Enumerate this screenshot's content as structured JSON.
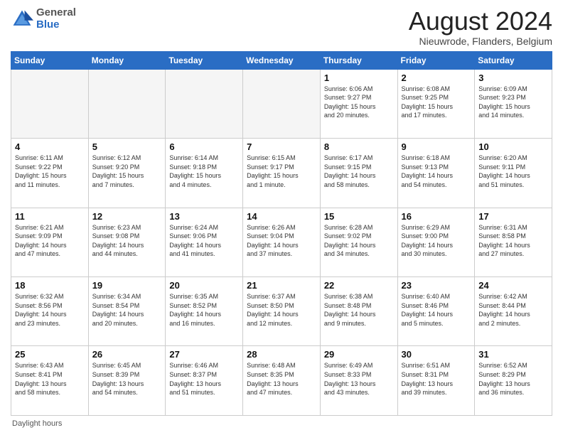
{
  "header": {
    "logo_general": "General",
    "logo_blue": "Blue",
    "month_title": "August 2024",
    "location": "Nieuwrode, Flanders, Belgium"
  },
  "days_of_week": [
    "Sunday",
    "Monday",
    "Tuesday",
    "Wednesday",
    "Thursday",
    "Friday",
    "Saturday"
  ],
  "footer_note": "Daylight hours",
  "weeks": [
    [
      {
        "day": "",
        "detail": ""
      },
      {
        "day": "",
        "detail": ""
      },
      {
        "day": "",
        "detail": ""
      },
      {
        "day": "",
        "detail": ""
      },
      {
        "day": "1",
        "detail": "Sunrise: 6:06 AM\nSunset: 9:27 PM\nDaylight: 15 hours\nand 20 minutes."
      },
      {
        "day": "2",
        "detail": "Sunrise: 6:08 AM\nSunset: 9:25 PM\nDaylight: 15 hours\nand 17 minutes."
      },
      {
        "day": "3",
        "detail": "Sunrise: 6:09 AM\nSunset: 9:23 PM\nDaylight: 15 hours\nand 14 minutes."
      }
    ],
    [
      {
        "day": "4",
        "detail": "Sunrise: 6:11 AM\nSunset: 9:22 PM\nDaylight: 15 hours\nand 11 minutes."
      },
      {
        "day": "5",
        "detail": "Sunrise: 6:12 AM\nSunset: 9:20 PM\nDaylight: 15 hours\nand 7 minutes."
      },
      {
        "day": "6",
        "detail": "Sunrise: 6:14 AM\nSunset: 9:18 PM\nDaylight: 15 hours\nand 4 minutes."
      },
      {
        "day": "7",
        "detail": "Sunrise: 6:15 AM\nSunset: 9:17 PM\nDaylight: 15 hours\nand 1 minute."
      },
      {
        "day": "8",
        "detail": "Sunrise: 6:17 AM\nSunset: 9:15 PM\nDaylight: 14 hours\nand 58 minutes."
      },
      {
        "day": "9",
        "detail": "Sunrise: 6:18 AM\nSunset: 9:13 PM\nDaylight: 14 hours\nand 54 minutes."
      },
      {
        "day": "10",
        "detail": "Sunrise: 6:20 AM\nSunset: 9:11 PM\nDaylight: 14 hours\nand 51 minutes."
      }
    ],
    [
      {
        "day": "11",
        "detail": "Sunrise: 6:21 AM\nSunset: 9:09 PM\nDaylight: 14 hours\nand 47 minutes."
      },
      {
        "day": "12",
        "detail": "Sunrise: 6:23 AM\nSunset: 9:08 PM\nDaylight: 14 hours\nand 44 minutes."
      },
      {
        "day": "13",
        "detail": "Sunrise: 6:24 AM\nSunset: 9:06 PM\nDaylight: 14 hours\nand 41 minutes."
      },
      {
        "day": "14",
        "detail": "Sunrise: 6:26 AM\nSunset: 9:04 PM\nDaylight: 14 hours\nand 37 minutes."
      },
      {
        "day": "15",
        "detail": "Sunrise: 6:28 AM\nSunset: 9:02 PM\nDaylight: 14 hours\nand 34 minutes."
      },
      {
        "day": "16",
        "detail": "Sunrise: 6:29 AM\nSunset: 9:00 PM\nDaylight: 14 hours\nand 30 minutes."
      },
      {
        "day": "17",
        "detail": "Sunrise: 6:31 AM\nSunset: 8:58 PM\nDaylight: 14 hours\nand 27 minutes."
      }
    ],
    [
      {
        "day": "18",
        "detail": "Sunrise: 6:32 AM\nSunset: 8:56 PM\nDaylight: 14 hours\nand 23 minutes."
      },
      {
        "day": "19",
        "detail": "Sunrise: 6:34 AM\nSunset: 8:54 PM\nDaylight: 14 hours\nand 20 minutes."
      },
      {
        "day": "20",
        "detail": "Sunrise: 6:35 AM\nSunset: 8:52 PM\nDaylight: 14 hours\nand 16 minutes."
      },
      {
        "day": "21",
        "detail": "Sunrise: 6:37 AM\nSunset: 8:50 PM\nDaylight: 14 hours\nand 12 minutes."
      },
      {
        "day": "22",
        "detail": "Sunrise: 6:38 AM\nSunset: 8:48 PM\nDaylight: 14 hours\nand 9 minutes."
      },
      {
        "day": "23",
        "detail": "Sunrise: 6:40 AM\nSunset: 8:46 PM\nDaylight: 14 hours\nand 5 minutes."
      },
      {
        "day": "24",
        "detail": "Sunrise: 6:42 AM\nSunset: 8:44 PM\nDaylight: 14 hours\nand 2 minutes."
      }
    ],
    [
      {
        "day": "25",
        "detail": "Sunrise: 6:43 AM\nSunset: 8:41 PM\nDaylight: 13 hours\nand 58 minutes."
      },
      {
        "day": "26",
        "detail": "Sunrise: 6:45 AM\nSunset: 8:39 PM\nDaylight: 13 hours\nand 54 minutes."
      },
      {
        "day": "27",
        "detail": "Sunrise: 6:46 AM\nSunset: 8:37 PM\nDaylight: 13 hours\nand 51 minutes."
      },
      {
        "day": "28",
        "detail": "Sunrise: 6:48 AM\nSunset: 8:35 PM\nDaylight: 13 hours\nand 47 minutes."
      },
      {
        "day": "29",
        "detail": "Sunrise: 6:49 AM\nSunset: 8:33 PM\nDaylight: 13 hours\nand 43 minutes."
      },
      {
        "day": "30",
        "detail": "Sunrise: 6:51 AM\nSunset: 8:31 PM\nDaylight: 13 hours\nand 39 minutes."
      },
      {
        "day": "31",
        "detail": "Sunrise: 6:52 AM\nSunset: 8:29 PM\nDaylight: 13 hours\nand 36 minutes."
      }
    ]
  ]
}
